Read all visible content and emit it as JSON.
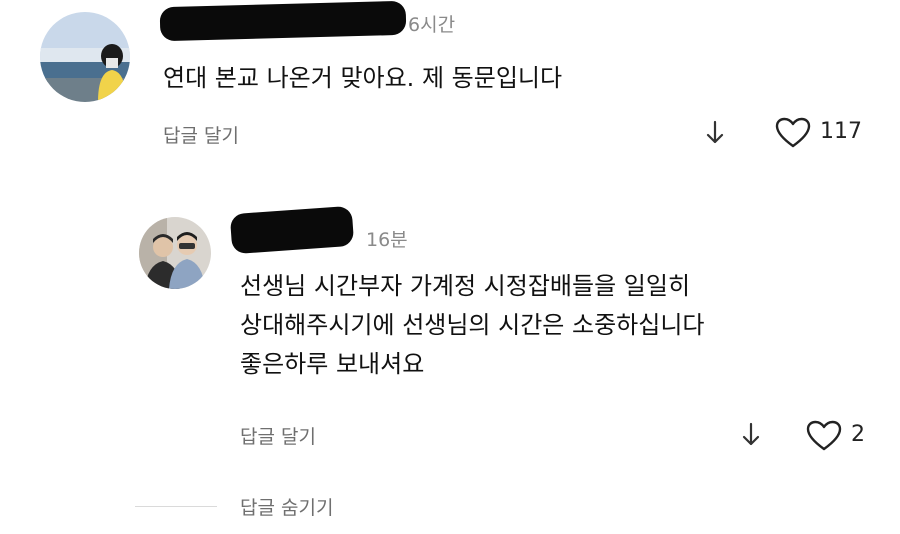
{
  "comments": [
    {
      "time": "6시간",
      "text": "연대 본교 나온거 맞아요. 제 동문입니다",
      "reply_label": "답글 달기",
      "like_count": "117"
    }
  ],
  "replies": [
    {
      "time": "16분",
      "lines": [
        "선생님 시간부자 가계정 시정잡배들을 일일히",
        "상대해주시기에 선생님의 시간은 소중하십니다",
        "좋은하루 보내셔요"
      ],
      "reply_label": "답글 달기",
      "like_count": "2"
    }
  ],
  "hide_replies_label": "답글 숨기기",
  "icons": {
    "download": "down-arrow-icon",
    "like": "heart-icon"
  }
}
